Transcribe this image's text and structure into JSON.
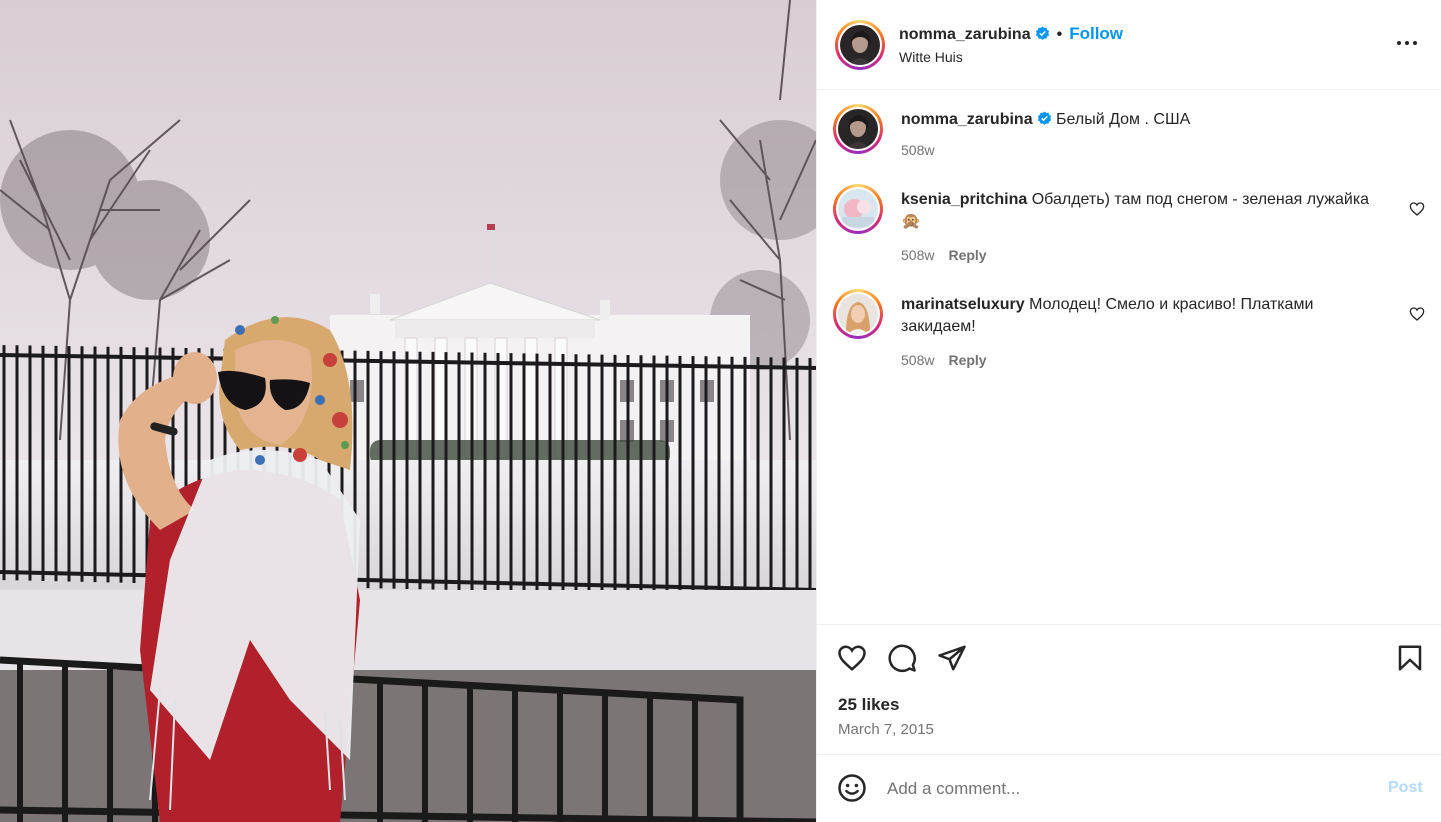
{
  "post": {
    "author": "nomma_zarubina",
    "location": "Witte Huis",
    "follow_label": "Follow",
    "dot": "•",
    "photo_icon": "photo-white-house",
    "caption": {
      "username": "nomma_zarubina",
      "text": "Белый Дом . США",
      "age": "508w"
    },
    "comments": [
      {
        "username": "ksenia_pritchina",
        "text": "Обалдеть) там под снегом - зеленая лужайка 🙊",
        "age": "508w",
        "reply_label": "Reply"
      },
      {
        "username": "marinatseluxury",
        "text": "Молодец! Смело и красиво! Платками закидаем!",
        "age": "508w",
        "reply_label": "Reply"
      }
    ],
    "likes": "25 likes",
    "date": "March 7, 2015",
    "add_comment_placeholder": "Add a comment...",
    "post_label": "Post"
  },
  "colors": {
    "follow": "#0095f6",
    "verified": "#0095f6",
    "post_disabled": "#b3dbff",
    "muted": "#737373"
  },
  "icons": [
    "verified-badge-icon",
    "more-options-icon",
    "heart-icon",
    "comment-icon",
    "share-icon",
    "bookmark-icon",
    "emoji-icon"
  ]
}
